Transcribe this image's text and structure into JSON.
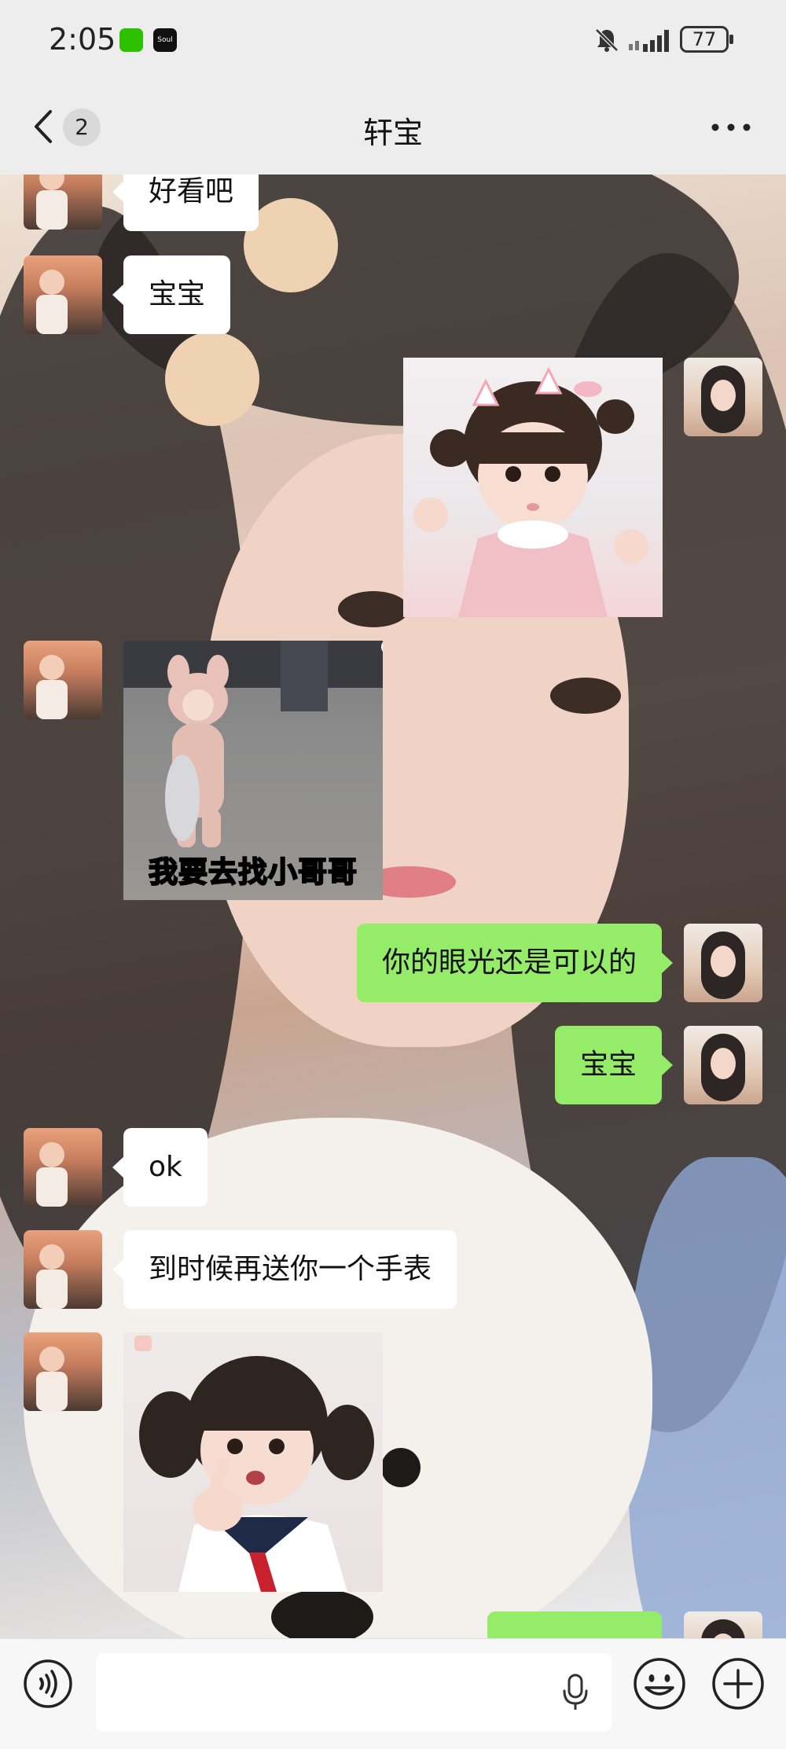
{
  "status_bar": {
    "time": "2:05",
    "soul_badge": "Soul",
    "battery": "77"
  },
  "header": {
    "unread_count": "2",
    "title": "轩宝"
  },
  "messages": [
    {
      "side": "left",
      "type": "text",
      "text": "好看吧"
    },
    {
      "side": "left",
      "type": "text",
      "text": "宝宝"
    },
    {
      "side": "right",
      "type": "sticker",
      "icon": "girl-cat-ears-sticker"
    },
    {
      "side": "left",
      "type": "sticker",
      "icon": "toddler-bunny-suit-sticker",
      "caption": "我要去找小哥哥"
    },
    {
      "side": "right",
      "type": "text",
      "text": "你的眼光还是可以的"
    },
    {
      "side": "right",
      "type": "text",
      "text": "宝宝"
    },
    {
      "side": "left",
      "type": "text",
      "text": "ok"
    },
    {
      "side": "left",
      "type": "text",
      "text": "到时候再送你一个手表"
    },
    {
      "side": "left",
      "type": "sticker",
      "icon": "girl-pointing-sticker"
    }
  ],
  "colors": {
    "sent_bubble": "#95ec69",
    "received_bubble": "#ffffff",
    "bar_background": "#ededed"
  }
}
